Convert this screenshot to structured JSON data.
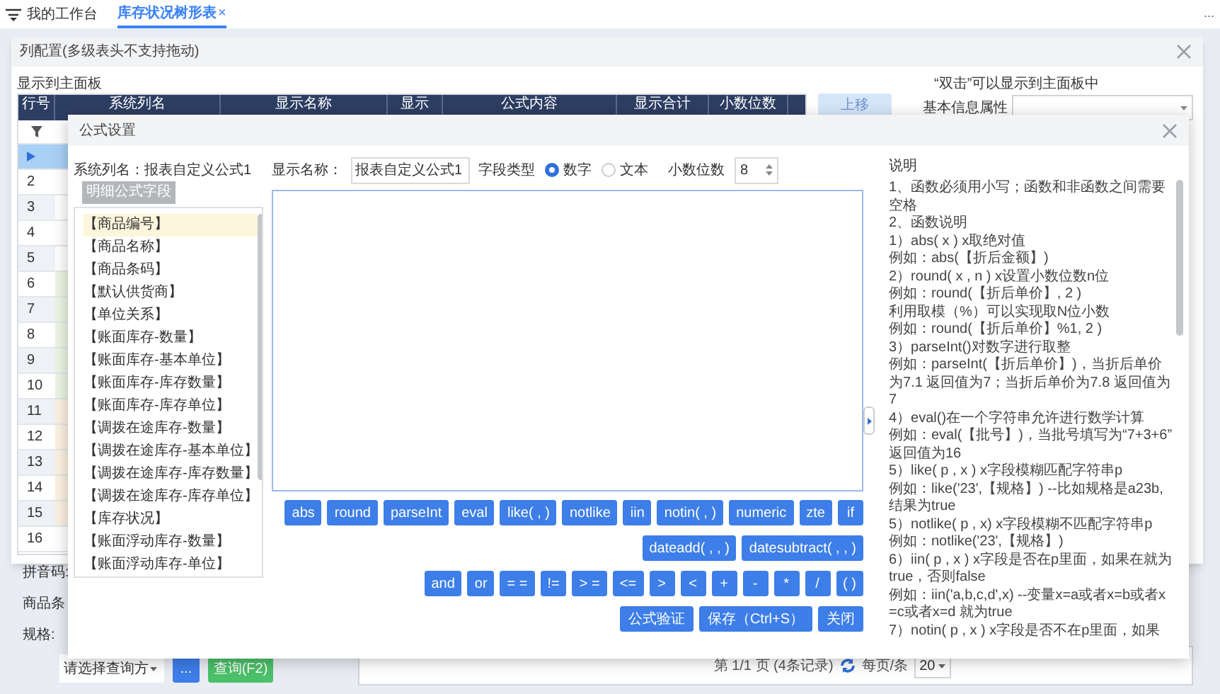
{
  "tabs": [
    {
      "label": "我的工作台",
      "selected": false
    },
    {
      "label": "库存状况树形表",
      "selected": true,
      "close_mark": "×"
    }
  ],
  "tab_bar_more": "...",
  "main_page": {
    "search_labels": [
      "拼音码:",
      "商品条",
      "规格:"
    ],
    "query_select": "请选择查询方",
    "more_button": "...",
    "query_button": "查询(F2)",
    "pagination": {
      "info": "第 1/1 页 (4条记录)",
      "per_page_label": "每页/条",
      "per_page": "20"
    }
  },
  "column_config": {
    "title": "列配置(多级表头不支持拖动)",
    "section_label": "显示到主面板",
    "columns": [
      "行号",
      "系统列名",
      "显示名称",
      "显示",
      "公式内容",
      "显示合计",
      "小数位数"
    ],
    "rows": [
      {
        "selected": true
      },
      {
        "number": "2",
        "selected": false
      },
      {
        "number": "3",
        "selected": false
      },
      {
        "number": "4",
        "selected": false
      },
      {
        "number": "5",
        "selected": false
      },
      {
        "number": "6",
        "selected": false,
        "color": "#eaf5e2"
      },
      {
        "number": "7",
        "selected": false,
        "color": "#eaf5e2"
      },
      {
        "number": "8",
        "selected": false,
        "color": "#eaf5e2"
      },
      {
        "number": "9",
        "selected": false,
        "color": "#eaf5e2"
      },
      {
        "number": "10",
        "selected": false,
        "color": "#eaf5e2"
      },
      {
        "number": "11",
        "selected": false,
        "color": "#fcf1e1"
      },
      {
        "number": "12",
        "selected": false,
        "color": "#fcf1e1"
      },
      {
        "number": "13",
        "selected": false,
        "color": "#fcf1e1"
      },
      {
        "number": "14",
        "selected": false,
        "color": "#fcf1e1"
      },
      {
        "number": "15",
        "selected": false,
        "color": "#fcf1e1"
      },
      {
        "number": "16",
        "selected": false
      }
    ],
    "move_up_button": {
      "label": "上移",
      "disabled": true
    },
    "hint": "“双击”可以显示到主面板中",
    "attribute_label": "基本信息属性"
  },
  "formula_dialog": {
    "title": "公式设置",
    "system_column": "系统列名：报表自定义公式1",
    "field_tab": "明细公式字段",
    "fields": [
      {
        "label": "【商品编号】",
        "selected": true
      },
      {
        "label": "【商品名称】",
        "selected": false
      },
      {
        "label": "【商品条码】",
        "selected": false
      },
      {
        "label": "【默认供货商】",
        "selected": false
      },
      {
        "label": "【单位关系】",
        "selected": false
      },
      {
        "label": "【账面库存-数量】",
        "selected": false
      },
      {
        "label": "【账面库存-基本单位】",
        "selected": false
      },
      {
        "label": "【账面库存-库存数量】",
        "selected": false
      },
      {
        "label": "【账面库存-库存单位】",
        "selected": false
      },
      {
        "label": "【调拨在途库存-数量】",
        "selected": false
      },
      {
        "label": "【调拨在途库存-基本单位】",
        "selected": false
      },
      {
        "label": "【调拨在途库存-库存数量】",
        "selected": false
      },
      {
        "label": "【调拨在途库存-库存单位】",
        "selected": false
      },
      {
        "label": "【库存状况】",
        "selected": false
      },
      {
        "label": "【账面浮动库存-数量】",
        "selected": false
      },
      {
        "label": "【账面浮动库存-单位】",
        "selected": false
      }
    ],
    "display_name_label": "显示名称：",
    "display_name": "报表自定义公式1",
    "field_type_label": "字段类型",
    "field_types": [
      {
        "label": "数字",
        "selected": true
      },
      {
        "label": "文本",
        "selected": false
      }
    ],
    "decimals_label": "小数位数",
    "decimals": "8",
    "function_buttons": [
      [
        "abs",
        "round",
        "parseInt",
        "eval",
        "like( , )",
        "notlike",
        "iin",
        "notin( , )",
        "numeric",
        "zte",
        "if"
      ],
      [
        "dateadd( , , )",
        "datesubtract( , , )"
      ],
      [
        "and",
        "or",
        "= =",
        "!=",
        "> =",
        "<=",
        ">",
        "<",
        "+",
        "-",
        "*",
        "/",
        "( )"
      ]
    ],
    "action_buttons": [
      "公式验证",
      "保存（Ctrl+S）",
      "关闭"
    ],
    "help_title": "说明",
    "help": [
      "1、函数必须用小写；函数和非函数之间需要空格",
      "2、函数说明",
      "1）abs( x ) x取绝对值",
      "例如：abs(【折后金额】)",
      "2）round( x , n ) x设置小数位数n位",
      "例如：round(【折后单价】, 2 )",
      "利用取模（%）可以实现取N位小数",
      "例如：round(【折后单价】%1, 2 )",
      "3）parseInt()对数字进行取整",
      "例如：parseInt(【折后单价】)，当折后单价为7.1 返回值为7；当折后单价为7.8 返回值为7",
      "4）eval()在一个字符串允许进行数学计算",
      "例如：eval(【批号】)，当批号填写为“7+3+6” 返回值为16",
      "5）like( p , x ) x字段模糊匹配字符串p",
      "例如：like('23',【规格】) --比如规格是a23b,结果为true",
      "5）notlike( p , x) x字段模糊不匹配字符串p",
      "例如：notlike('23',【规格】)",
      "6）iin( p , x ) x字段是否在p里面，如果在就为true，否则false",
      "例如：iin('a,b,c,d',x) --变量x=a或者x=b或者x=c或者x=d 就为true",
      "7）notin( p , x ) x字段是否不在p里面，如果"
    ]
  }
}
